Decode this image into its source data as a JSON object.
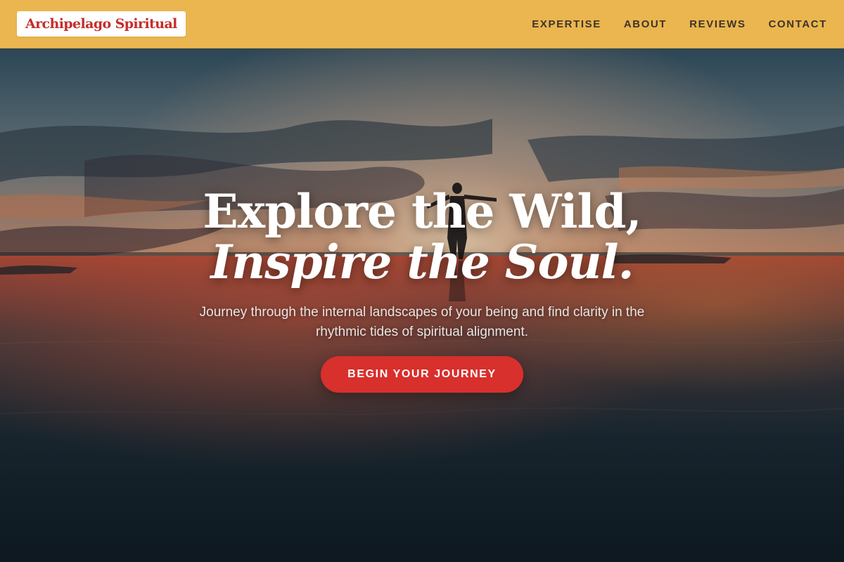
{
  "header": {
    "logo_text": "Archipelago Spiritual",
    "nav": [
      {
        "label": "EXPERTISE"
      },
      {
        "label": "ABOUT"
      },
      {
        "label": "REVIEWS"
      },
      {
        "label": "CONTACT"
      }
    ]
  },
  "hero": {
    "headline_line1": "Explore the Wild,",
    "headline_line2": "Inspire the Soul.",
    "subtext": "Journey through the internal landscapes of your being and find clarity in the rhythmic tides of spiritual alignment.",
    "cta_label": "BEGIN YOUR JOURNEY",
    "background_image": "sunset-beach-silhouette-photo"
  },
  "colors": {
    "header_bg": "#ebb650",
    "logo_text": "#c62d2a",
    "nav_text": "#3c3428",
    "cta_bg": "#d8302c",
    "cta_text": "#ffffff",
    "headline_text": "#ffffff"
  }
}
